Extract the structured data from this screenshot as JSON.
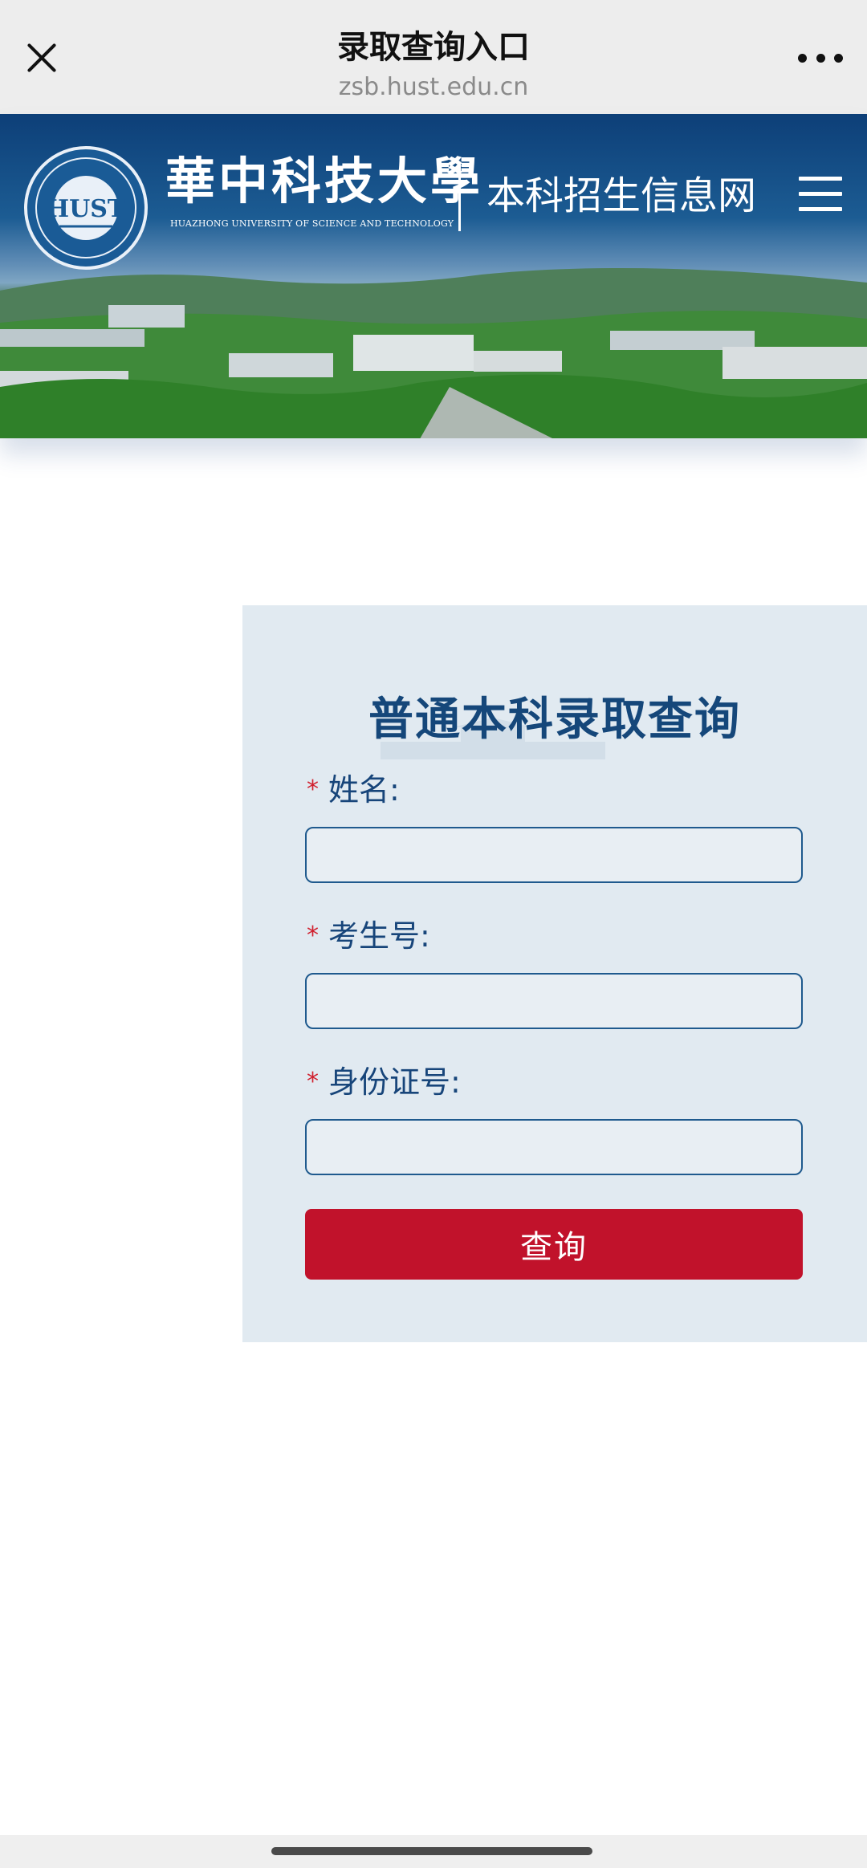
{
  "browser": {
    "title": "录取查询入口",
    "url": "zsb.hust.edu.cn",
    "close_icon": "close-icon",
    "more_icon": "more-icon"
  },
  "banner": {
    "university_name_cn": "華中科技大學",
    "university_name_en": "HUAZHONG UNIVERSITY OF SCIENCE AND TECHNOLOGY",
    "site_name": "本科招生信息网",
    "menu_icon": "hamburger-menu-icon"
  },
  "form": {
    "title": "普通本科录取查询",
    "required_mark": "*",
    "fields": [
      {
        "label": "姓名:",
        "value": "",
        "placeholder": ""
      },
      {
        "label": "考生号:",
        "value": "",
        "placeholder": ""
      },
      {
        "label": "身份证号:",
        "value": "",
        "placeholder": ""
      }
    ],
    "submit_label": "查询"
  },
  "colors": {
    "brand_blue": "#15477a",
    "submit_red": "#c1122b",
    "required_red": "#d0202e",
    "card_bg": "#e1eaf1"
  }
}
